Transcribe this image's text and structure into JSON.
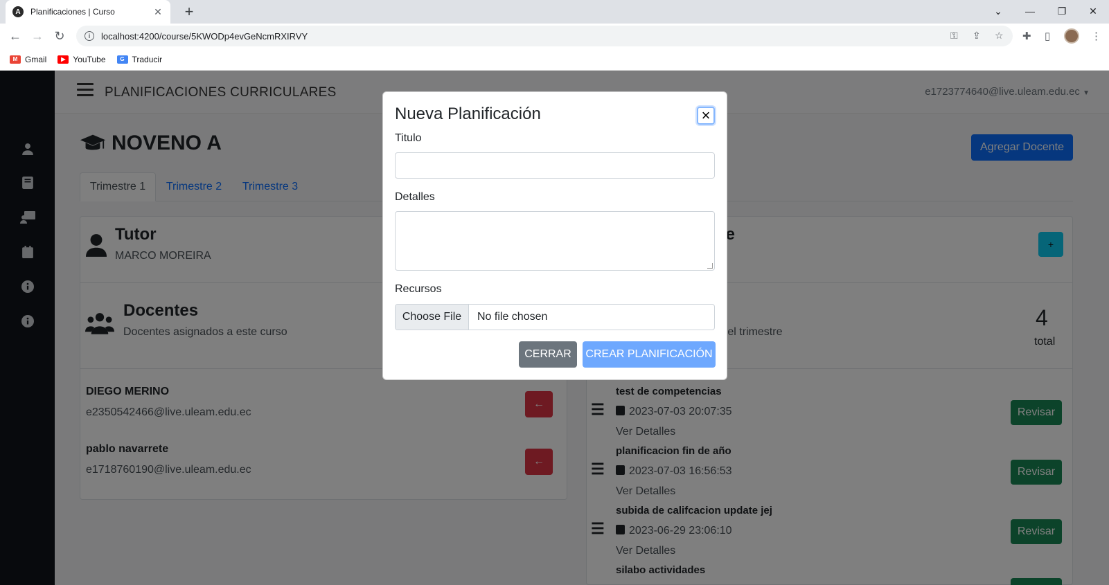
{
  "browser": {
    "tab_title": "Planificaciones | Curso",
    "tab_icon": "A",
    "url": "localhost:4200/course/5KWODp4evGeNcmRXIRVY",
    "bookmarks": [
      {
        "label": "Gmail",
        "color": "#ea4335"
      },
      {
        "label": "YouTube",
        "color": "#ff0000"
      },
      {
        "label": "Traducir",
        "color": "#4285f4"
      }
    ]
  },
  "header": {
    "brand": "PLANIFICACIONES CURRICULARES",
    "user_email": "e1723774640@live.uleam.edu.ec"
  },
  "sidebar": {
    "icons": [
      "user-icon",
      "book-icon",
      "teacher-icon",
      "calendar-icon",
      "info-icon",
      "info-icon"
    ]
  },
  "course": {
    "title": "NOVENO A",
    "add_teacher_label": "Agregar Docente",
    "tabs": [
      {
        "label": "Trimestre 1",
        "active": true
      },
      {
        "label": "Trimestre 2",
        "active": false
      },
      {
        "label": "Trimestre 3",
        "active": false
      }
    ]
  },
  "tutor": {
    "heading": "Tutor",
    "name": "MARCO MOREIRA"
  },
  "docentes": {
    "heading": "Docentes",
    "subtitle": "Docentes asignados a este curso",
    "items": [
      {
        "name": "DIEGO MERINO",
        "email": "e2350542466@live.uleam.edu.ec"
      },
      {
        "name": "pablo navarrete",
        "email": "e1718760190@live.uleam.edu.ec"
      }
    ]
  },
  "planificaciones": {
    "heading_partial": "stre",
    "subtitle_partial": "e el trimestre",
    "add_label": "+",
    "count": "4",
    "count_label": "total",
    "review_label": "Revisar",
    "details_label": "Ver Detalles",
    "items": [
      {
        "title": "test de competencias",
        "date": "2023-07-03 20:07:35"
      },
      {
        "title": "planificacion fin de año",
        "date": "2023-07-03 16:56:53"
      },
      {
        "title": "subida de califcacion update jej",
        "date": "2023-06-29 23:06:10"
      },
      {
        "title": "silabo actividades",
        "date": ""
      }
    ]
  },
  "modal": {
    "title": "Nueva Planificación",
    "close_symbol": "×",
    "titulo_label": "Titulo",
    "detalles_label": "Detalles",
    "recursos_label": "Recursos",
    "file_button": "Choose File",
    "file_status": "No file chosen",
    "cancel_label": "CERRAR",
    "submit_label": "CREAR PLANIFICACIÓN"
  }
}
